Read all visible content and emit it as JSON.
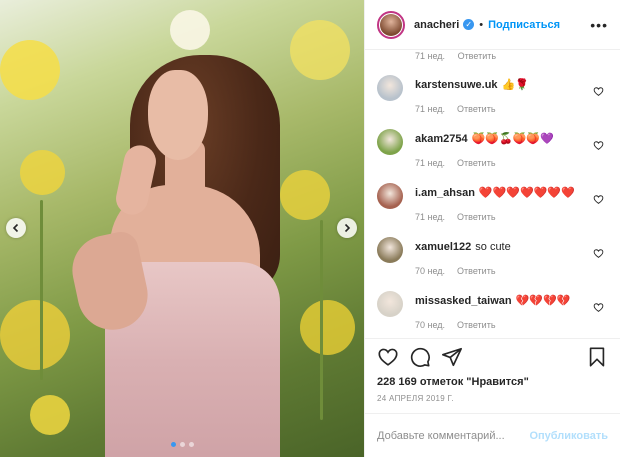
{
  "post": {
    "username": "anacheri",
    "separator": "•",
    "follow_label": "Подписаться",
    "more_label": "•••"
  },
  "comments_partial": {
    "time": "71 нед.",
    "reply_label": "Ответить"
  },
  "comments": [
    {
      "user": "karstensuwe.uk",
      "text": "👍🌹",
      "time": "71 нед.",
      "reply": "Ответить",
      "avatar_color": "#b8c2cc"
    },
    {
      "user": "akam2754",
      "text": "🍑🍑🍒🍑🍑💜",
      "time": "71 нед.",
      "reply": "Ответить",
      "avatar_color": "#7ea34a"
    },
    {
      "user": "i.am_ahsan",
      "text": "❤️❤️❤️❤️❤️❤️❤️",
      "time": "71 нед.",
      "reply": "Ответить",
      "avatar_color": "#a5614f"
    },
    {
      "user": "xamuel122",
      "text": "so cute",
      "time": "70 нед.",
      "reply": "Ответить",
      "avatar_color": "#8a7b5a"
    },
    {
      "user": "missasked_taiwan",
      "text": "💔💔💔💔",
      "time": "70 нед.",
      "reply": "Ответить",
      "avatar_color": "#d7d2c8"
    }
  ],
  "likes": "228 169 отметок \"Нравится\"",
  "date": "24 АПРЕЛЯ 2019 Г.",
  "add_comment": {
    "placeholder": "Добавьте комментарий...",
    "publish_label": "Опубликовать"
  },
  "icons": {
    "like": "heart-icon",
    "comment": "comment-icon",
    "share": "share-icon",
    "save": "bookmark-icon",
    "prev": "chevron-left-icon",
    "next": "chevron-right-icon"
  },
  "colors": {
    "accent": "#0095f6",
    "muted": "#8e8e8e",
    "verified": "#3897f0",
    "publish_disabled": "#b2dffc"
  },
  "carousel": {
    "count": 3,
    "active_index": 0
  }
}
